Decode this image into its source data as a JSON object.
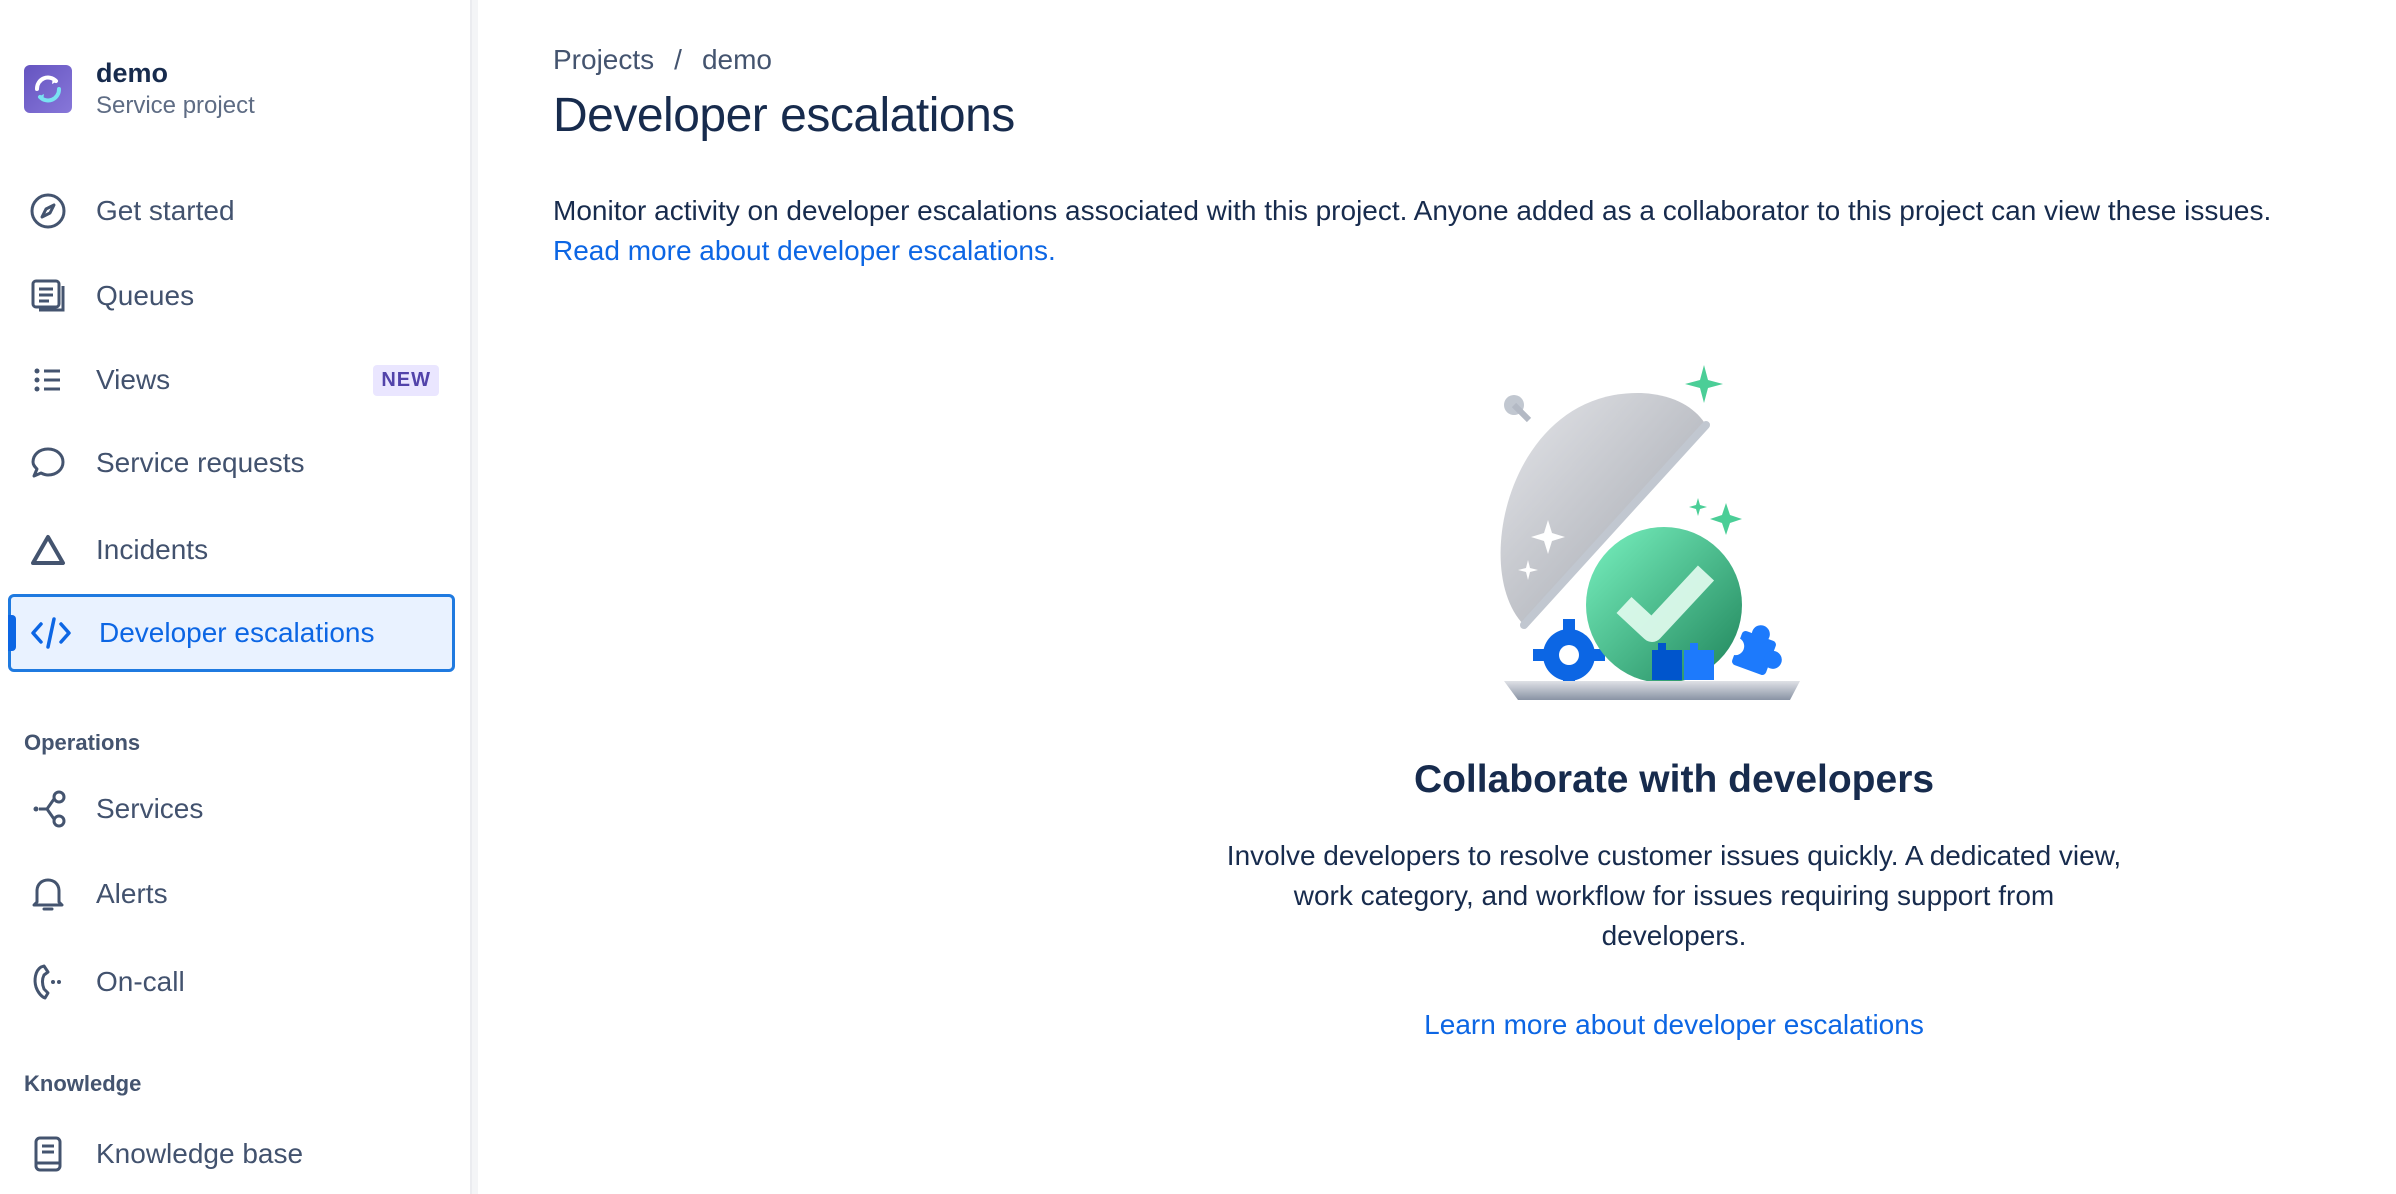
{
  "project": {
    "name": "demo",
    "type": "Service project"
  },
  "nav": {
    "get_started": "Get started",
    "queues": "Queues",
    "views": "Views",
    "views_badge": "NEW",
    "service_requests": "Service requests",
    "incidents": "Incidents",
    "developer_escalations": "Developer escalations"
  },
  "sections": {
    "operations": "Operations",
    "services": "Services",
    "alerts": "Alerts",
    "oncall": "On-call",
    "knowledge": "Knowledge",
    "knowledge_base": "Knowledge base"
  },
  "breadcrumb": {
    "root": "Projects",
    "sep": "/",
    "current": "demo"
  },
  "page": {
    "title": "Developer escalations",
    "description": "Monitor activity on developer escalations associated with this project. Anyone added as a collaborator to this project can view these issues.",
    "read_more": "Read more about developer escalations."
  },
  "empty_state": {
    "title": "Collaborate with developers",
    "description": "Involve developers to resolve customer issues quickly. A dedicated view, work category, and workflow for issues requiring support from developers.",
    "link": "Learn more about developer escalations"
  },
  "colors": {
    "accent": "#0c66e4",
    "text": "#172b4d",
    "subtle": "#44546f",
    "badge_bg": "#eae6ff",
    "success": "#36b37e"
  }
}
